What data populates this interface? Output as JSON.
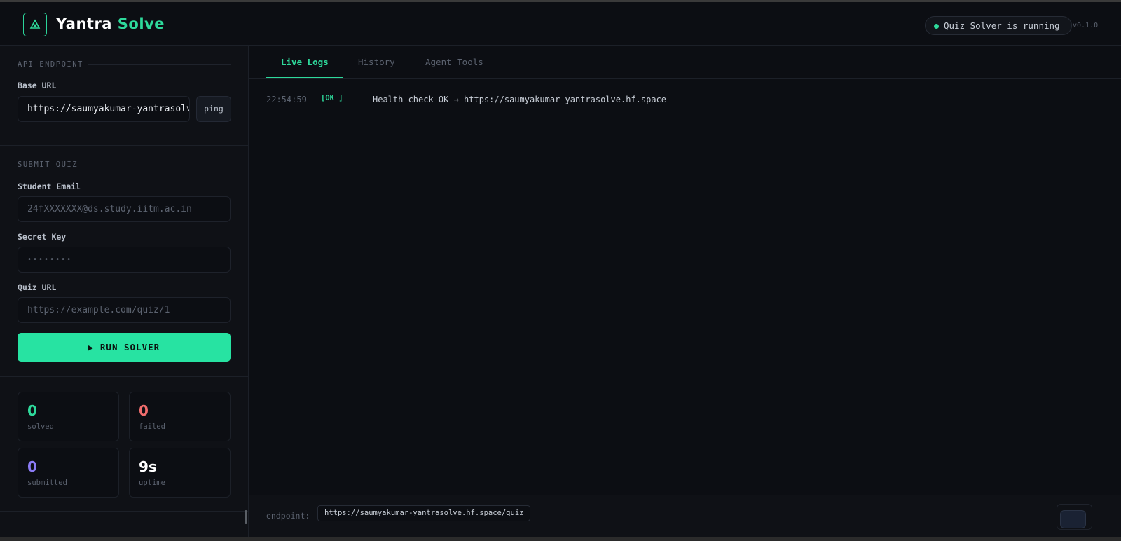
{
  "header": {
    "brand_word1": "Yantra",
    "brand_word2": "Solve",
    "status": "Quiz Solver is running",
    "version": "v0.1.0",
    "logo_icon": "triangle-logo-icon"
  },
  "sidebar": {
    "api": {
      "title": "API ENDPOINT",
      "base_url_label": "Base URL",
      "base_url_value": "https://saumyakumar-yantrasolve.hf.space",
      "ping_label": "ping"
    },
    "submit": {
      "title": "SUBMIT QUIZ",
      "email_label": "Student Email",
      "email_placeholder": "24fXXXXXXX@ds.study.iitm.ac.in",
      "secret_label": "Secret Key",
      "secret_placeholder": "••••••••",
      "quiz_label": "Quiz URL",
      "quiz_placeholder": "https://example.com/quiz/1",
      "run_label": "▶ RUN SOLVER"
    },
    "stats": [
      {
        "value": "0",
        "label": "solved",
        "color": "#2ed99b"
      },
      {
        "value": "0",
        "label": "failed",
        "color": "#f26d6d"
      },
      {
        "value": "0",
        "label": "submitted",
        "color": "#8b7bf5"
      },
      {
        "value": "9s",
        "label": "uptime",
        "color": "#ffffff"
      }
    ]
  },
  "main": {
    "tabs": [
      {
        "label": "Live Logs",
        "active": true
      },
      {
        "label": "History",
        "active": false
      },
      {
        "label": "Agent Tools",
        "active": false
      }
    ],
    "logs": [
      {
        "time": "22:54:59",
        "level": "[OK ]",
        "message": "Health check OK → https://saumyakumar-yantrasolve.hf.space"
      }
    ],
    "footer": {
      "label": "endpoint:",
      "endpoint": "https://saumyakumar-yantrasolve.hf.space/quiz"
    }
  },
  "colors": {
    "accent": "#2ed99b",
    "danger": "#f26d6d",
    "purple": "#8b7bf5",
    "background": "#0c0e13"
  }
}
